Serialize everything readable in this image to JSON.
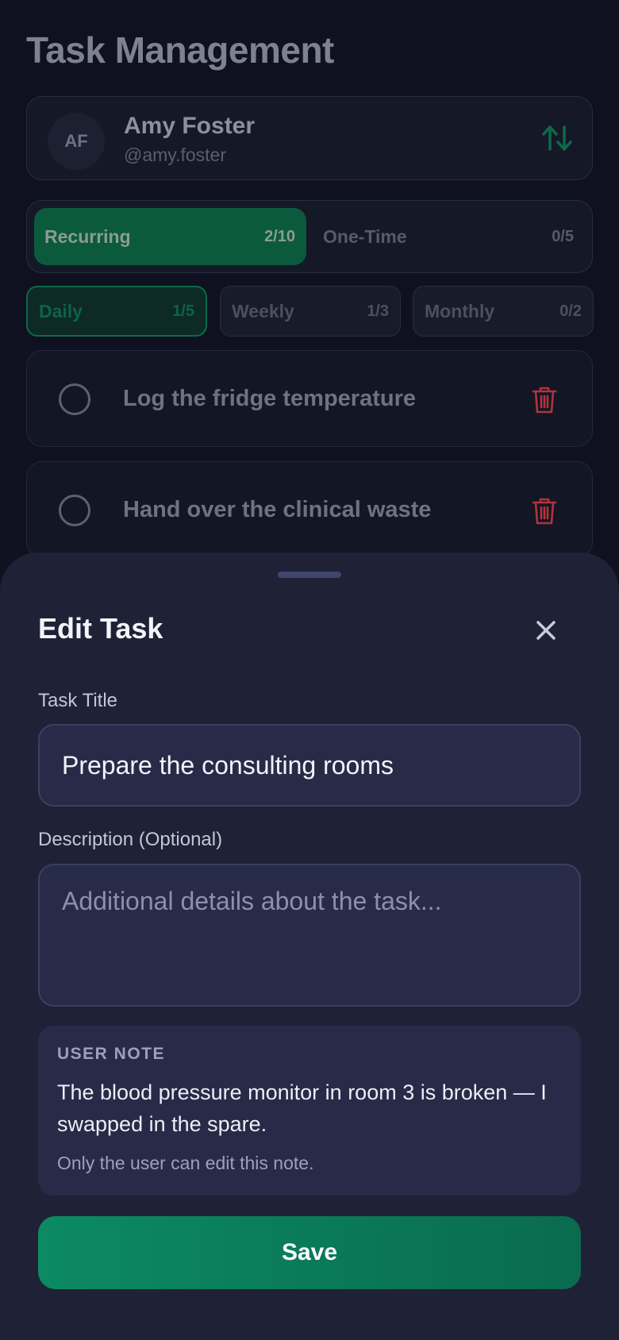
{
  "header": {
    "title": "Task Management"
  },
  "user": {
    "initials": "AF",
    "name": "Amy Foster",
    "handle": "@amy.foster"
  },
  "type_tabs": [
    {
      "label": "Recurring",
      "count": "2/10",
      "active": true
    },
    {
      "label": "One-Time",
      "count": "0/5",
      "active": false
    }
  ],
  "frequency_tabs": [
    {
      "label": "Daily",
      "count": "1/5",
      "active": true
    },
    {
      "label": "Weekly",
      "count": "1/3",
      "active": false
    },
    {
      "label": "Monthly",
      "count": "0/2",
      "active": false
    }
  ],
  "tasks": [
    {
      "title": "Log the fridge temperature",
      "done": false
    },
    {
      "title": "Hand over the clinical waste",
      "done": false
    }
  ],
  "sheet": {
    "title": "Edit Task",
    "title_label": "Task Title",
    "title_value": "Prepare the consulting rooms",
    "description_label": "Description (Optional)",
    "description_placeholder": "Additional details about the task...",
    "note_heading": "USER NOTE",
    "note_text": "The blood pressure monitor in room 3 is broken — I swapped in the spare.",
    "note_caption": "Only the user can edit this note.",
    "save_label": "Save"
  },
  "colors": {
    "accent": "#0b8a63",
    "danger": "#b3333a",
    "sheet_bg": "#1f2137",
    "page_bg": "#0f1120"
  },
  "icons": {
    "sort": "sort-arrows-icon",
    "delete": "trash-icon",
    "close": "close-icon",
    "check": "circle-checkbox-icon"
  }
}
